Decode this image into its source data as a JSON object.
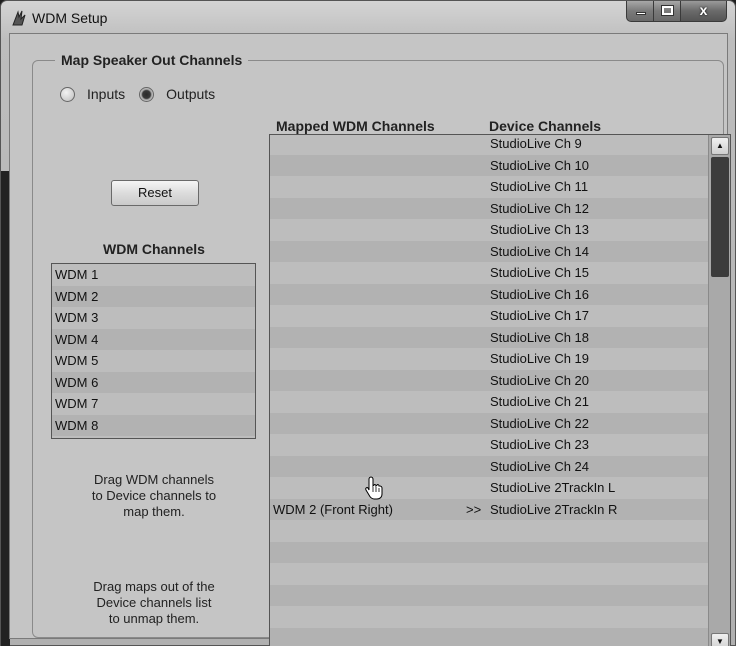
{
  "window": {
    "title": "WDM Setup"
  },
  "group": {
    "title": "Map Speaker Out Channels"
  },
  "mode": {
    "inputs_label": "Inputs",
    "outputs_label": "Outputs",
    "selected": "Outputs"
  },
  "reset_label": "Reset",
  "wdm": {
    "heading": "WDM Channels",
    "items": [
      "WDM 1",
      "WDM 2",
      "WDM 3",
      "WDM 4",
      "WDM 5",
      "WDM 6",
      "WDM 7",
      "WDM 8"
    ]
  },
  "hints": {
    "drag_to_map": [
      "Drag WDM channels",
      "to Device channels to",
      "map them."
    ],
    "drag_to_unmap": [
      "Drag maps out of the",
      "Device channels list",
      "to unmap them."
    ]
  },
  "mapping": {
    "mapped_header": "Mapped WDM Channels",
    "device_header": "Device Channels",
    "rows": [
      {
        "mapped": "",
        "arrow": "",
        "device": "StudioLive Ch 9"
      },
      {
        "mapped": "",
        "arrow": "",
        "device": "StudioLive Ch 10"
      },
      {
        "mapped": "",
        "arrow": "",
        "device": "StudioLive Ch 11"
      },
      {
        "mapped": "",
        "arrow": "",
        "device": "StudioLive Ch 12"
      },
      {
        "mapped": "",
        "arrow": "",
        "device": "StudioLive Ch 13"
      },
      {
        "mapped": "",
        "arrow": "",
        "device": "StudioLive Ch 14"
      },
      {
        "mapped": "",
        "arrow": "",
        "device": "StudioLive Ch 15"
      },
      {
        "mapped": "",
        "arrow": "",
        "device": "StudioLive Ch 16"
      },
      {
        "mapped": "",
        "arrow": "",
        "device": "StudioLive Ch 17"
      },
      {
        "mapped": "",
        "arrow": "",
        "device": "StudioLive Ch 18"
      },
      {
        "mapped": "",
        "arrow": "",
        "device": "StudioLive Ch 19"
      },
      {
        "mapped": "",
        "arrow": "",
        "device": "StudioLive Ch 20"
      },
      {
        "mapped": "",
        "arrow": "",
        "device": "StudioLive Ch 21"
      },
      {
        "mapped": "",
        "arrow": "",
        "device": "StudioLive Ch 22"
      },
      {
        "mapped": "",
        "arrow": "",
        "device": "StudioLive Ch 23"
      },
      {
        "mapped": "",
        "arrow": "",
        "device": "StudioLive Ch 24"
      },
      {
        "mapped": "",
        "arrow": "",
        "device": "StudioLive 2TrackIn L"
      },
      {
        "mapped": "WDM 2 (Front Right)",
        "arrow": ">>",
        "device": "StudioLive 2TrackIn R"
      },
      {
        "mapped": "",
        "arrow": "",
        "device": ""
      },
      {
        "mapped": "",
        "arrow": "",
        "device": ""
      },
      {
        "mapped": "",
        "arrow": "",
        "device": ""
      },
      {
        "mapped": "",
        "arrow": "",
        "device": ""
      },
      {
        "mapped": "",
        "arrow": "",
        "device": ""
      },
      {
        "mapped": "",
        "arrow": "",
        "device": ""
      },
      {
        "mapped": "",
        "arrow": "",
        "device": ""
      }
    ]
  },
  "icons": {
    "app": "presonus-app-icon",
    "minimize": "minimize-icon",
    "maximize": "maximize-icon",
    "close": "close-icon",
    "scroll_up": "scroll-up-arrow-icon",
    "scroll_down": "scroll-down-arrow-icon",
    "cursor": "hand-pointer-cursor-icon"
  }
}
